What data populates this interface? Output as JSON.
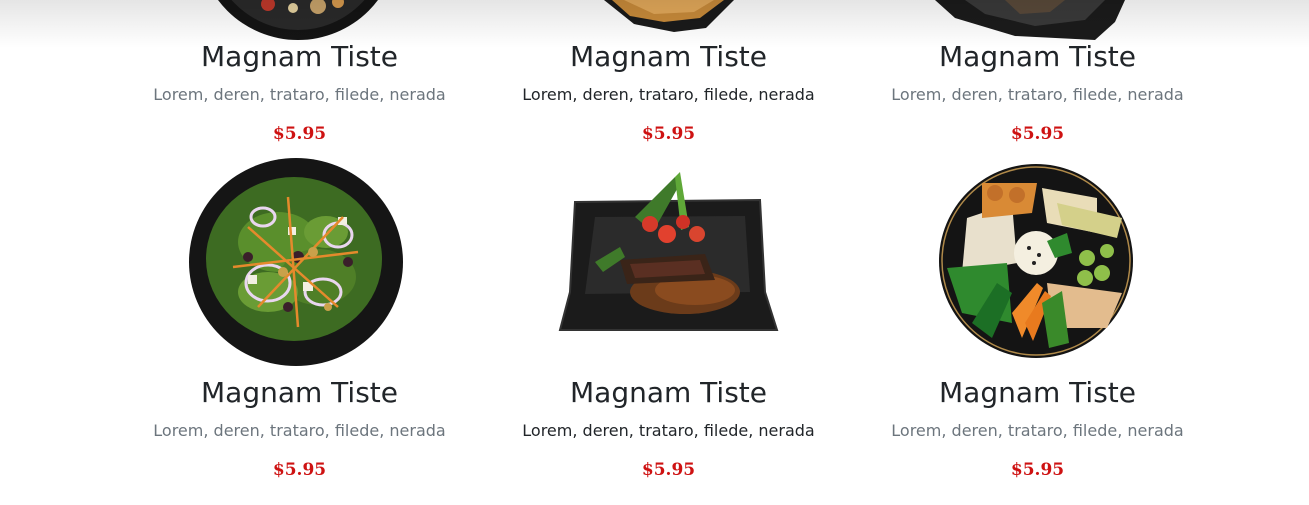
{
  "menu": {
    "items": [
      {
        "name": "Magnam Tiste",
        "ingredients": "Lorem, deren, trataro, filede, nerada",
        "price": "$5.95",
        "image_icon": "salad-bowl-image"
      },
      {
        "name": "Magnam Tiste",
        "ingredients": "Lorem, deren, trataro, filede, nerada",
        "price": "$5.95",
        "image_icon": "pancake-plate-image"
      },
      {
        "name": "Magnam Tiste",
        "ingredients": "Lorem, deren, trataro, filede, nerada",
        "price": "$5.95",
        "image_icon": "dark-plate-image"
      },
      {
        "name": "Magnam Tiste",
        "ingredients": "Lorem, deren, trataro, filede, nerada",
        "price": "$5.95",
        "image_icon": "green-salad-image"
      },
      {
        "name": "Magnam Tiste",
        "ingredients": "Lorem, deren, trataro, filede, nerada",
        "price": "$5.95",
        "image_icon": "steak-plate-image"
      },
      {
        "name": "Magnam Tiste",
        "ingredients": "Lorem, deren, trataro, filede, nerada",
        "price": "$5.95",
        "image_icon": "poke-bowl-image"
      }
    ]
  },
  "colors": {
    "price": "#ce1212",
    "name": "#212529",
    "muted": "#6c757d"
  }
}
